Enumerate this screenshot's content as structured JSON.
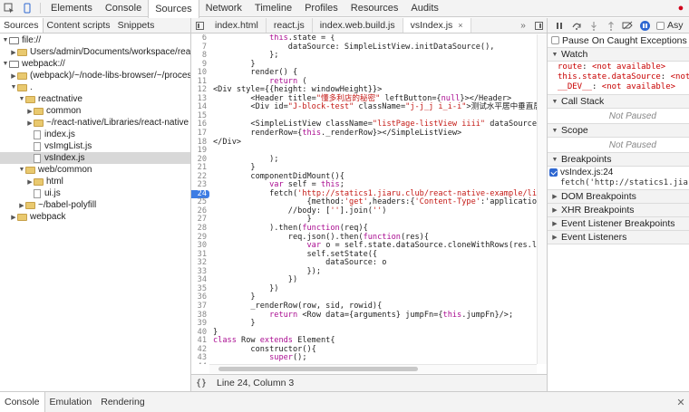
{
  "toolbar": {
    "tabs": [
      "Elements",
      "Console",
      "Sources",
      "Network",
      "Timeline",
      "Profiles",
      "Resources",
      "Audits"
    ],
    "active_tab": "Sources"
  },
  "navigator": {
    "tabs": [
      "Sources",
      "Content scripts",
      "Snippets"
    ],
    "tree": [
      {
        "label": "file://",
        "depth": 0,
        "kind": "domain",
        "expanded": true
      },
      {
        "label": "Users/admin/Documents/workspace/react-m",
        "depth": 1,
        "kind": "folder",
        "expanded": false
      },
      {
        "label": "webpack://",
        "depth": 0,
        "kind": "domain",
        "expanded": true
      },
      {
        "label": "(webpack)/~/node-libs-browser/~/process",
        "depth": 1,
        "kind": "folder",
        "expanded": false
      },
      {
        "label": ".",
        "depth": 1,
        "kind": "folder",
        "expanded": true
      },
      {
        "label": "reactnative",
        "depth": 2,
        "kind": "folder",
        "expanded": true
      },
      {
        "label": "common",
        "depth": 3,
        "kind": "folder",
        "expanded": false
      },
      {
        "label": "~/react-native/Libraries/react-native",
        "depth": 3,
        "kind": "folder",
        "expanded": false
      },
      {
        "label": "index.js",
        "depth": 3,
        "kind": "file"
      },
      {
        "label": "vsImgList.js",
        "depth": 3,
        "kind": "file"
      },
      {
        "label": "vsIndex.js",
        "depth": 3,
        "kind": "file",
        "selected": true
      },
      {
        "label": "web/common",
        "depth": 2,
        "kind": "folder",
        "expanded": true
      },
      {
        "label": "html",
        "depth": 3,
        "kind": "folder",
        "expanded": false
      },
      {
        "label": "ui.js",
        "depth": 3,
        "kind": "file"
      },
      {
        "label": "~/babel-polyfill",
        "depth": 2,
        "kind": "folder",
        "expanded": false
      },
      {
        "label": "webpack",
        "depth": 1,
        "kind": "folder",
        "expanded": false
      }
    ]
  },
  "editor": {
    "tabs": [
      {
        "label": "index.html",
        "active": false
      },
      {
        "label": "react.js",
        "active": false
      },
      {
        "label": "index.web.build.js",
        "active": false
      },
      {
        "label": "vsIndex.js",
        "active": true,
        "close": "×"
      }
    ],
    "breakpoint_line": "24",
    "lines": [
      {
        "n": "6",
        "t": "            this.state = {"
      },
      {
        "n": "7",
        "t": "                dataSource: SimpleListView.initDataSource(),"
      },
      {
        "n": "8",
        "t": "            };"
      },
      {
        "n": "9",
        "t": "        }"
      },
      {
        "n": "10",
        "t": "        render() {"
      },
      {
        "n": "11",
        "t": "            return ("
      },
      {
        "n": "12",
        "t": "<Div style={{height: windowHeight}}>"
      },
      {
        "n": "13",
        "t": "        <Header title=\"懂多利店的秘密\" leftButton={null}></Header>"
      },
      {
        "n": "14",
        "t": "        <Div id=\"J-block-test\" className=\"j-j_j i_i-i\">测试水平居中垂直居中</Div>"
      },
      {
        "n": "15",
        "t": ""
      },
      {
        "n": "16",
        "t": "        <SimpleListView className=\"listPage-listView iiii\" dataSource={this.st"
      },
      {
        "n": "17",
        "t": "        renderRow={this._renderRow}></SimpleListView>"
      },
      {
        "n": "18",
        "t": "</Div>"
      },
      {
        "n": "19",
        "t": ""
      },
      {
        "n": "20",
        "t": "            );"
      },
      {
        "n": "21",
        "t": "        }"
      },
      {
        "n": "22",
        "t": "        componentDidMount(){"
      },
      {
        "n": "23",
        "t": "            var self = this;"
      },
      {
        "n": "24",
        "t": "            fetch('http://statics1.jiaru.club/react-native-example/list.js',"
      },
      {
        "n": "25",
        "t": "                    {method:'get',headers:{'Content-Type':'application/json;c"
      },
      {
        "n": "26",
        "t": "                //body: [''].join('')"
      },
      {
        "n": "27",
        "t": "                    }"
      },
      {
        "n": "28",
        "t": "            ).then(function(req){"
      },
      {
        "n": "29",
        "t": "                req.json().then(function(res){"
      },
      {
        "n": "30",
        "t": "                    var o = self.state.dataSource.cloneWithRows(res.list);"
      },
      {
        "n": "31",
        "t": "                    self.setState({"
      },
      {
        "n": "32",
        "t": "                        dataSource: o"
      },
      {
        "n": "33",
        "t": "                    });"
      },
      {
        "n": "34",
        "t": "                })"
      },
      {
        "n": "35",
        "t": "            })"
      },
      {
        "n": "36",
        "t": "        }"
      },
      {
        "n": "37",
        "t": "        _renderRow(row, sid, rowid){"
      },
      {
        "n": "38",
        "t": "            return <Row data={arguments} jumpFn={this.jumpFn}/>;"
      },
      {
        "n": "39",
        "t": "        }"
      },
      {
        "n": "40",
        "t": "}"
      },
      {
        "n": "41",
        "t": "class Row extends Element{"
      },
      {
        "n": "42",
        "t": "        constructor(){"
      },
      {
        "n": "43",
        "t": "            super();"
      },
      {
        "n": "44",
        "t": ""
      }
    ],
    "status_braces": "{}",
    "cursor_position": "Line 24, Column 3"
  },
  "debugger": {
    "async_label": "Asy",
    "pause_on_caught": "Pause On Caught Exceptions",
    "watch_title": "Watch",
    "watch_items": [
      {
        "key": "route",
        "value": "<not available>"
      },
      {
        "key": "this.state.dataSource",
        "value": "<not a"
      },
      {
        "key": "__DEV__",
        "value": "<not available>"
      }
    ],
    "call_stack_title": "Call Stack",
    "call_stack_status": "Not Paused",
    "scope_title": "Scope",
    "scope_status": "Not Paused",
    "breakpoints_title": "Breakpoints",
    "breakpoint_label": "vsIndex.js:24",
    "breakpoint_code": "fetch('http://statics1.jiaru.",
    "collapsed_sections": [
      "DOM Breakpoints",
      "XHR Breakpoints",
      "Event Listener Breakpoints",
      "Event Listeners"
    ]
  },
  "drawer": {
    "tabs": [
      "Console",
      "Emulation",
      "Rendering"
    ],
    "active_tab": "Console"
  },
  "colors": {
    "keyword": "#aa0d91",
    "string": "#c41a16",
    "breakpoint": "#3d7de4",
    "watch_value": "#c80000"
  }
}
